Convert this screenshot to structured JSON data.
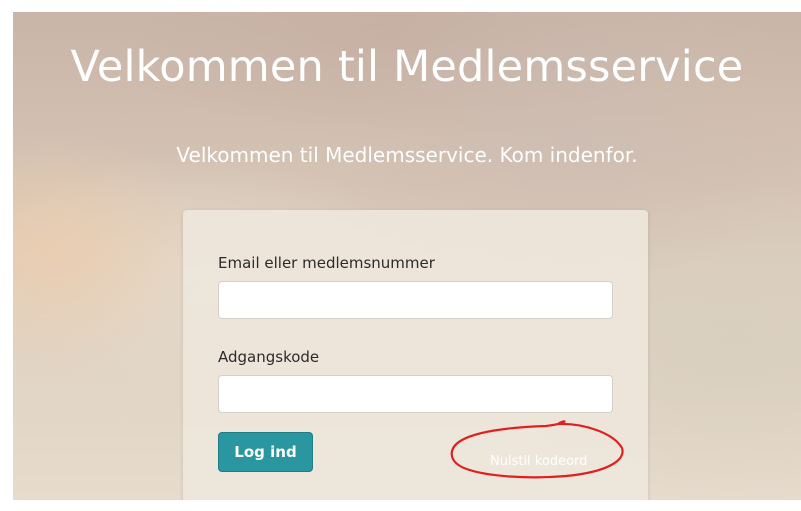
{
  "hero": {
    "title": "Velkommen til Medlemsservice",
    "subtitle": "Velkommen til Medlemsservice. Kom indenfor."
  },
  "login_form": {
    "email_label": "Email eller medlemsnummer",
    "email_value": "",
    "email_placeholder": "",
    "password_label": "Adgangskode",
    "password_value": "",
    "password_placeholder": "",
    "submit_label": "Log ind",
    "reset_link_label": "Nulstil kodeord"
  },
  "annotation": {
    "circle_color": "#e02020"
  },
  "colors": {
    "button_bg": "#2a96a0",
    "card_bg": "#eee6db",
    "hero_text": "#ffffff"
  }
}
